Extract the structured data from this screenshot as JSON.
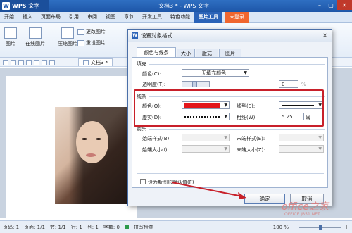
{
  "app": {
    "name": "WPS 文字",
    "window_title": "文档3 * - WPS 文字"
  },
  "menu": {
    "items": [
      "开始",
      "插入",
      "页面布局",
      "引用",
      "审阅",
      "视图",
      "章节",
      "开发工具",
      "特色功能",
      "图片工具"
    ],
    "active": "图片工具",
    "login": "未登录"
  },
  "ribbon": {
    "buttons": [
      "图片",
      "在线图片",
      "压缩图片",
      "更改图片",
      "重设图片"
    ]
  },
  "tabbar": {
    "doc_tab": "文档3 *"
  },
  "dialog": {
    "title": "设置对象格式",
    "close": "×",
    "tabs": [
      "颜色与线条",
      "大小",
      "版式",
      "图片"
    ],
    "active_tab": "颜色与线条",
    "fill": {
      "section": "填充",
      "color_label": "颜色(C):",
      "color_value": "无填充颜色",
      "transparency_label": "透明度(T):",
      "transparency_value": "0",
      "transparency_unit": "%"
    },
    "line": {
      "section": "线条",
      "color_label": "颜色(O):",
      "color_swatch": "#e3161c",
      "style_label": "线型(S):",
      "dash_label": "虚实(D):",
      "weight_label": "粗细(W):",
      "weight_value": "5.25",
      "weight_unit": "磅"
    },
    "arrows": {
      "section": "箭头",
      "begin_style": "始端样式(B):",
      "end_style": "末端样式(E):",
      "begin_size": "始端大小(I):",
      "end_size": "末端大小(Z):"
    },
    "default_checkbox": "设为新图形默认值(F)",
    "ok": "确定",
    "cancel": "取消"
  },
  "status": {
    "page": "页码: 1",
    "pages": "页面: 1/1",
    "section": "节: 1/1",
    "row": "行: 1",
    "col": "列: 1",
    "words": "字数: 0",
    "spell": "拼写检查",
    "zoom": "100 %"
  },
  "watermark": {
    "brand": "office之家",
    "url": "OFFICE.JB51.NET"
  },
  "colors": {
    "accent": "#2b63b8",
    "highlight": "#c8202a",
    "line_color": "#e3161c"
  }
}
